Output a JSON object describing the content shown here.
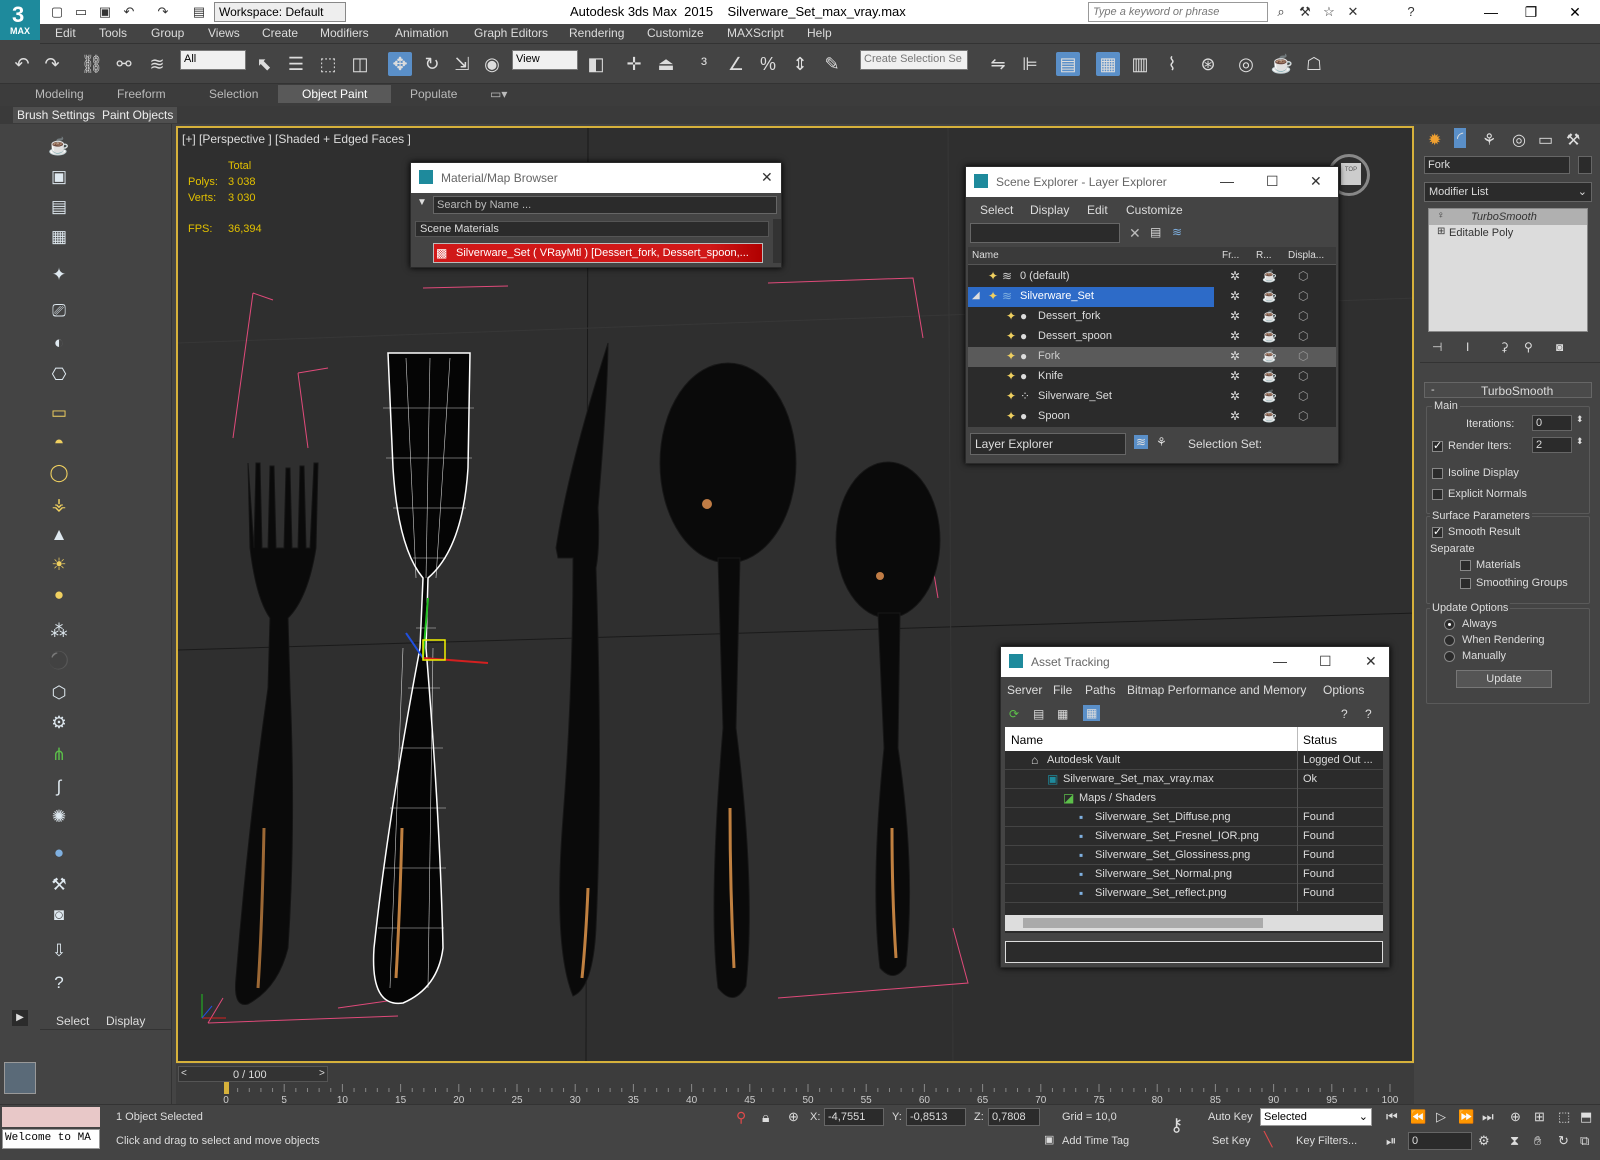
{
  "app": {
    "title": "Autodesk 3ds Max  2015    Silverware_Set_max_vray.max",
    "workspace": "Workspace: Default",
    "search_placeholder": "Type a keyword or phrase",
    "logo_text": "MAX"
  },
  "menu": [
    "Edit",
    "Tools",
    "Group",
    "Views",
    "Create",
    "Modifiers",
    "Animation",
    "Graph Editors",
    "Rendering",
    "Customize",
    "MAXScript",
    "Help"
  ],
  "toolbar": {
    "filter": "All",
    "ref_coord": "View",
    "selection_set_placeholder": "Create Selection Se"
  },
  "ribbon": {
    "tabs": [
      "Modeling",
      "Freeform",
      "Selection",
      "Object Paint",
      "Populate"
    ],
    "active": "Object Paint",
    "sub": [
      "Brush Settings",
      "Paint Objects"
    ]
  },
  "viewport": {
    "label": "[+] [Perspective ] [Shaded + Edged Faces ]",
    "stats": {
      "total_label": "Total",
      "polys_label": "Polys:",
      "polys": "3 038",
      "verts_label": "Verts:",
      "verts": "3 030",
      "fps_label": "FPS:",
      "fps": "36,394"
    }
  },
  "material_browser": {
    "title": "Material/Map Browser",
    "search_placeholder": "Search by Name ...",
    "section": "Scene Materials",
    "item": "Silverware_Set  ( VRayMtl ) [Dessert_fork, Dessert_spoon,..."
  },
  "scene_explorer": {
    "title": "Scene Explorer - Layer Explorer",
    "menu": [
      "Select",
      "Display",
      "Edit",
      "Customize"
    ],
    "columns": [
      "Name",
      "Fr...",
      "R...",
      "Displa..."
    ],
    "rows": [
      {
        "name": "0 (default)",
        "level": 0
      },
      {
        "name": "Silverware_Set",
        "level": 0
      },
      {
        "name": "Dessert_fork",
        "level": 1
      },
      {
        "name": "Dessert_spoon",
        "level": 1
      },
      {
        "name": "Fork",
        "level": 1
      },
      {
        "name": "Knife",
        "level": 1
      },
      {
        "name": "Silverware_Set",
        "level": 1
      },
      {
        "name": "Spoon",
        "level": 1
      }
    ],
    "footer_explorer": "Layer Explorer",
    "footer_selection": "Selection Set:"
  },
  "asset_tracking": {
    "title": "Asset Tracking",
    "menu": [
      "Server",
      "File",
      "Paths",
      "Bitmap Performance and Memory",
      "Options"
    ],
    "columns": [
      "Name",
      "Status"
    ],
    "rows": [
      {
        "name": "Autodesk Vault",
        "status": "Logged Out ...",
        "level": 0
      },
      {
        "name": "Silverware_Set_max_vray.max",
        "status": "Ok",
        "level": 1
      },
      {
        "name": "Maps / Shaders",
        "status": "",
        "level": 2
      },
      {
        "name": "Silverware_Set_Diffuse.png",
        "status": "Found",
        "level": 3
      },
      {
        "name": "Silverware_Set_Fresnel_IOR.png",
        "status": "Found",
        "level": 3
      },
      {
        "name": "Silverware_Set_Glossiness.png",
        "status": "Found",
        "level": 3
      },
      {
        "name": "Silverware_Set_Normal.png",
        "status": "Found",
        "level": 3
      },
      {
        "name": "Silverware_Set_reflect.png",
        "status": "Found",
        "level": 3
      }
    ]
  },
  "modify_panel": {
    "object_name": "Fork",
    "modifier_list": "Modifier List",
    "stack": [
      "TurboSmooth",
      "Editable Poly"
    ],
    "rollout_title": "TurboSmooth",
    "main_label": "Main",
    "iterations_label": "Iterations:",
    "iterations": "0",
    "render_iters_label": "Render Iters:",
    "render_iters": "2",
    "isoline": "Isoline Display",
    "explicit": "Explicit Normals",
    "surface_params": "Surface Parameters",
    "smooth_result": "Smooth Result",
    "separate": "Separate",
    "materials": "Materials",
    "smoothing_groups": "Smoothing Groups",
    "update_options": "Update Options",
    "always": "Always",
    "when_rendering": "When Rendering",
    "manually": "Manually",
    "update_btn": "Update"
  },
  "left_panel": {
    "select": "Select",
    "display": "Display"
  },
  "timeline": {
    "frame": "0 / 100",
    "ticks": [
      "0",
      "5",
      "10",
      "15",
      "20",
      "25",
      "30",
      "35",
      "40",
      "45",
      "50",
      "55",
      "60",
      "65",
      "70",
      "75",
      "80",
      "85",
      "90",
      "95",
      "100"
    ]
  },
  "statusbar": {
    "script": "Welcome to MA",
    "selected": "1 Object Selected",
    "prompt": "Click and drag to select and move objects",
    "x_label": "X:",
    "x": "-4,7551",
    "y_label": "Y:",
    "y": "-0,8513",
    "z_label": "Z:",
    "z": "0,7808",
    "grid": "Grid = 10,0",
    "add_time_tag": "Add Time Tag",
    "auto_key": "Auto Key",
    "set_key": "Set Key",
    "key_mode": "Selected",
    "key_filters": "Key Filters...",
    "frame_value": "0"
  },
  "colors": {
    "accent": "#5a8fc8",
    "viewport_border": "#d6b13b",
    "selection_highlight": "#2d6bc8"
  }
}
